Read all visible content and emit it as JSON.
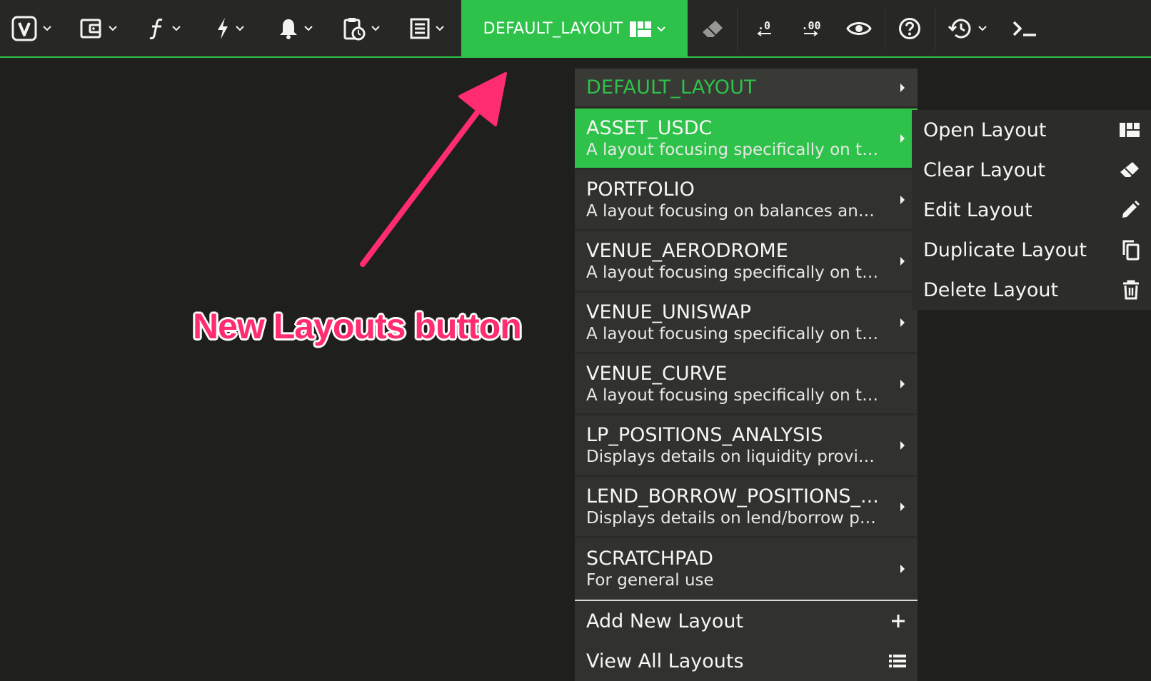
{
  "toolbar": {
    "icons": [
      "vega-logo-icon",
      "wallet-icon",
      "function-icon",
      "bolt-icon",
      "bell-icon",
      "clipboard-clock-icon",
      "receipt-icon",
      "eraser-icon",
      "decimal-decrease-icon",
      "decimal-increase-icon",
      "eye-icon",
      "help-icon",
      "history-icon",
      "terminal-icon"
    ],
    "decimal_decrease": ".0",
    "decimal_increase": ".00",
    "layout_button_label": "DEFAULT_LAYOUT"
  },
  "menu": {
    "header": "DEFAULT_LAYOUT",
    "items": [
      {
        "name": "ASSET_USDC",
        "desc": "A layout focusing specifically on th...",
        "active": true
      },
      {
        "name": "PORTFOLIO",
        "desc": "A layout focusing on balances and ..."
      },
      {
        "name": "VENUE_AERODROME",
        "desc": "A layout focusing specifically on th..."
      },
      {
        "name": "VENUE_UNISWAP",
        "desc": "A layout focusing specifically on th..."
      },
      {
        "name": "VENUE_CURVE",
        "desc": "A layout focusing specifically on th..."
      },
      {
        "name": "LP_POSITIONS_ANALYSIS",
        "desc": "Displays details on liquidity provid..."
      },
      {
        "name": "LEND_BORROW_POSITIONS_...",
        "desc": "Displays details on lend/borrow po..."
      },
      {
        "name": "SCRATCHPAD",
        "desc": "For general use"
      }
    ],
    "footer": [
      {
        "name": "Add New Layout",
        "icon": "plus-icon"
      },
      {
        "name": "View All Layouts",
        "icon": "list-icon"
      }
    ]
  },
  "submenu": {
    "items": [
      {
        "name": "Open Layout",
        "icon": "layout-grid-icon"
      },
      {
        "name": "Clear Layout",
        "icon": "eraser-icon"
      },
      {
        "name": "Edit Layout",
        "icon": "pencil-icon"
      },
      {
        "name": "Duplicate Layout",
        "icon": "copy-icon"
      },
      {
        "name": "Delete Layout",
        "icon": "trash-icon"
      }
    ]
  },
  "annotation": {
    "text": "New Layouts button",
    "color": "#ff2d6f"
  },
  "colors": {
    "accent": "#2ec24a",
    "background": "#1f1f1d",
    "toolbar": "#272725",
    "menu": "#31312e"
  }
}
